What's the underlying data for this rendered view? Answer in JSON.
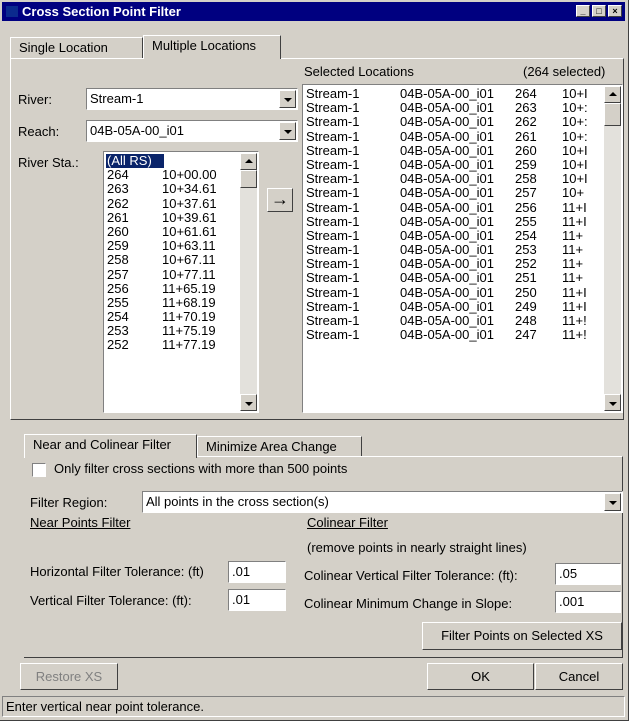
{
  "window": {
    "title": "Cross Section Point Filter"
  },
  "tabs": [
    "Single Location",
    "Multiple Locations"
  ],
  "left": {
    "river_label": "River:",
    "river_value": "Stream-1",
    "reach_label": "Reach:",
    "reach_value": "04B-05A-00_i01",
    "station_label": "River Sta.:",
    "stations": [
      [
        "(All RS)",
        ""
      ],
      [
        "264",
        "10+00.00"
      ],
      [
        "263",
        "10+34.61"
      ],
      [
        "262",
        "10+37.61"
      ],
      [
        "261",
        "10+39.61"
      ],
      [
        "260",
        "10+61.61"
      ],
      [
        "259",
        "10+63.11"
      ],
      [
        "258",
        "10+67.11"
      ],
      [
        "257",
        "10+77.11"
      ],
      [
        "256",
        "11+65.19"
      ],
      [
        "255",
        "11+68.19"
      ],
      [
        "254",
        "11+70.19"
      ],
      [
        "253",
        "11+75.19"
      ],
      [
        "252",
        "11+77.19"
      ]
    ],
    "add_arrow": "→"
  },
  "selected": {
    "title": "Selected Locations",
    "count": "(264 selected)",
    "rows": [
      [
        "Stream-1",
        "04B-05A-00_i01",
        "264",
        "10+I"
      ],
      [
        "Stream-1",
        "04B-05A-00_i01",
        "263",
        "10+:"
      ],
      [
        "Stream-1",
        "04B-05A-00_i01",
        "262",
        "10+:"
      ],
      [
        "Stream-1",
        "04B-05A-00_i01",
        "261",
        "10+:"
      ],
      [
        "Stream-1",
        "04B-05A-00_i01",
        "260",
        "10+I"
      ],
      [
        "Stream-1",
        "04B-05A-00_i01",
        "259",
        "10+I"
      ],
      [
        "Stream-1",
        "04B-05A-00_i01",
        "258",
        "10+I"
      ],
      [
        "Stream-1",
        "04B-05A-00_i01",
        "257",
        "10+"
      ],
      [
        "Stream-1",
        "04B-05A-00_i01",
        "256",
        "11+I"
      ],
      [
        "Stream-1",
        "04B-05A-00_i01",
        "255",
        "11+I"
      ],
      [
        "Stream-1",
        "04B-05A-00_i01",
        "254",
        "11+"
      ],
      [
        "Stream-1",
        "04B-05A-00_i01",
        "253",
        "11+"
      ],
      [
        "Stream-1",
        "04B-05A-00_i01",
        "252",
        "11+"
      ],
      [
        "Stream-1",
        "04B-05A-00_i01",
        "251",
        "11+"
      ],
      [
        "Stream-1",
        "04B-05A-00_i01",
        "250",
        "11+I"
      ],
      [
        "Stream-1",
        "04B-05A-00_i01",
        "249",
        "11+I"
      ],
      [
        "Stream-1",
        "04B-05A-00_i01",
        "248",
        "11+!"
      ],
      [
        "Stream-1",
        "04B-05A-00_i01",
        "247",
        "11+!"
      ]
    ]
  },
  "filter_tabs": [
    "Near and Colinear Filter",
    "Minimize Area Change"
  ],
  "only_filter_label": "Only filter cross sections with more than 500 points",
  "only_filter_checked": false,
  "filter_region_label": "Filter Region:",
  "filter_region_value": "All points in the cross section(s)",
  "near": {
    "heading": "Near Points Filter",
    "horizontal_label": "Horizontal Filter Tolerance: (ft)",
    "horizontal_value": ".01",
    "vertical_label": "Vertical Filter Tolerance: (ft):",
    "vertical_value": ".01"
  },
  "colinear": {
    "heading": "Colinear Filter",
    "subheading": "(remove points in nearly straight lines)",
    "vertical_label": "Colinear Vertical Filter Tolerance: (ft):",
    "vertical_value": ".05",
    "slope_label": "Colinear Minimum Change in Slope:",
    "slope_value": ".001"
  },
  "buttons": {
    "filter_selected": "Filter Points on Selected XS",
    "restore": "Restore XS",
    "ok": "OK",
    "cancel": "Cancel"
  },
  "status": "Enter vertical near point tolerance."
}
